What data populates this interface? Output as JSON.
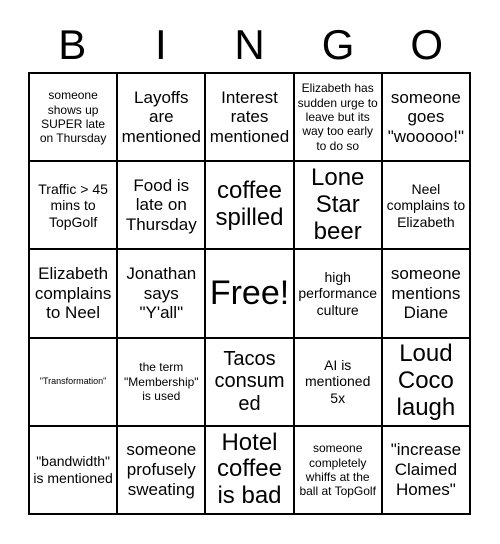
{
  "card": {
    "header_letters": [
      "B",
      "I",
      "N",
      "G",
      "O"
    ],
    "columns": 5,
    "rows": 5,
    "border_color": "#000000",
    "background_color": "#ffffff",
    "text_color": "#000000",
    "cells": [
      [
        {
          "text": "someone shows up SUPER late on Thursday",
          "size": "sz-s"
        },
        {
          "text": "Layoffs are mentioned",
          "size": "sz-l"
        },
        {
          "text": "Interest rates mentioned",
          "size": "sz-l"
        },
        {
          "text": "Elizabeth has sudden urge to leave but its way too early to do so",
          "size": "sz-s"
        },
        {
          "text": "someone goes \"wooooo!\"",
          "size": "sz-l"
        }
      ],
      [
        {
          "text": "Traffic > 45 mins to TopGolf",
          "size": "sz-m"
        },
        {
          "text": "Food is late on Thursday",
          "size": "sz-l"
        },
        {
          "text": "coffee spilled",
          "size": "sz-xxl"
        },
        {
          "text": "Lone Star beer",
          "size": "sz-xxl"
        },
        {
          "text": "Neel complains to Elizabeth",
          "size": "sz-m"
        }
      ],
      [
        {
          "text": "Elizabeth complains to Neel",
          "size": "sz-l"
        },
        {
          "text": "Jonathan says \"Y'all\"",
          "size": "sz-l"
        },
        {
          "text": "Free!",
          "size": "sz-free"
        },
        {
          "text": "high performance culture",
          "size": "sz-m"
        },
        {
          "text": "someone mentions Diane",
          "size": "sz-l"
        }
      ],
      [
        {
          "text": "\"Transformation\"",
          "size": "sz-xs"
        },
        {
          "text": "the term \"Membership\" is used",
          "size": "sz-s"
        },
        {
          "text": "Tacos consumed",
          "size": "sz-xl"
        },
        {
          "text": "AI is mentioned 5x",
          "size": "sz-m"
        },
        {
          "text": "Loud Coco laugh",
          "size": "sz-xxl"
        }
      ],
      [
        {
          "text": "\"bandwidth\" is mentioned",
          "size": "sz-m"
        },
        {
          "text": "someone profusely sweating",
          "size": "sz-l"
        },
        {
          "text": "Hotel coffee is bad",
          "size": "sz-xxl"
        },
        {
          "text": "someone completely whiffs at the ball at TopGolf",
          "size": "sz-s"
        },
        {
          "text": "\"increase Claimed Homes\"",
          "size": "sz-l"
        }
      ]
    ]
  }
}
